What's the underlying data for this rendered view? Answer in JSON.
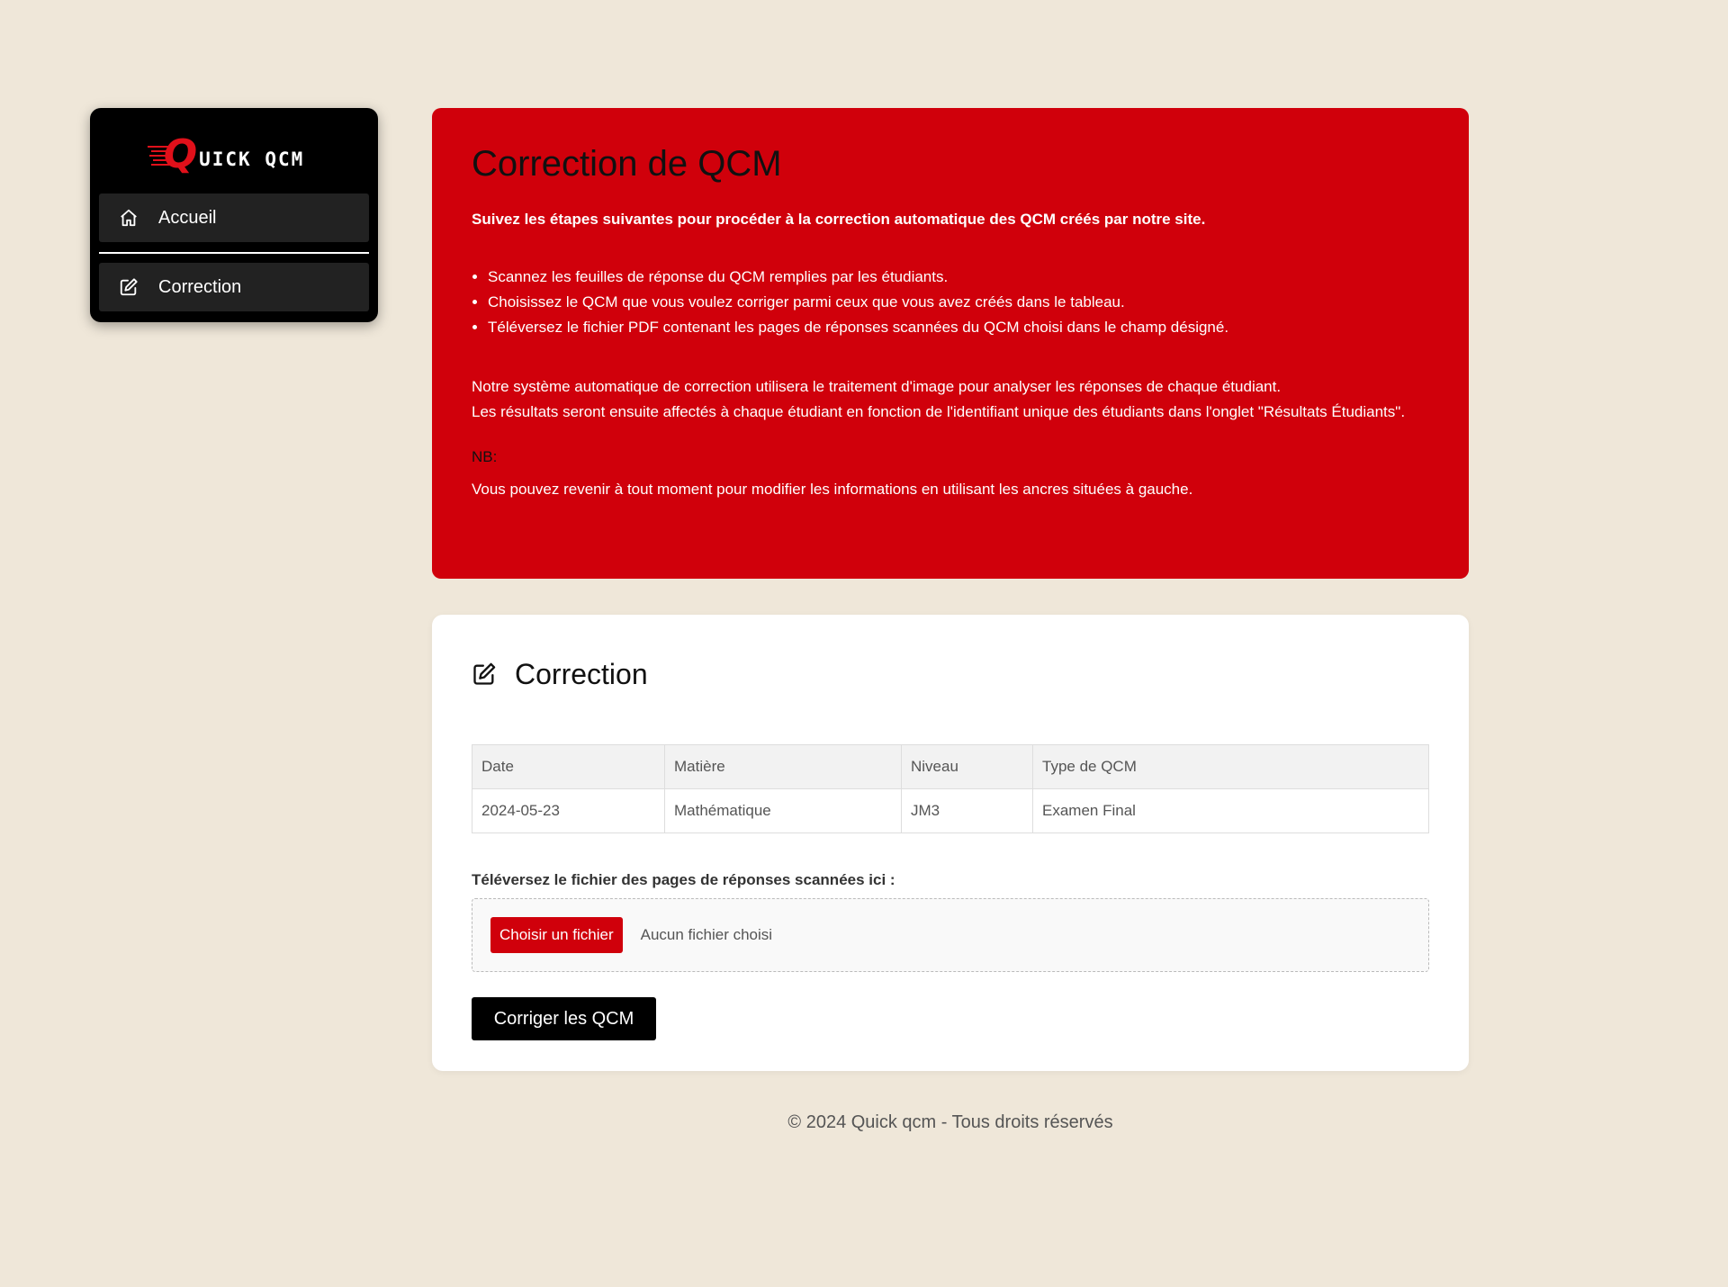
{
  "sidebar": {
    "logo": {
      "initial": "Q",
      "rest": "uick qcm"
    },
    "items": [
      {
        "label": "Accueil",
        "icon": "home-icon"
      },
      {
        "label": "Correction",
        "icon": "edit-icon"
      }
    ]
  },
  "intro": {
    "title": "Correction de QCM",
    "lead": "Suivez les étapes suivantes pour procéder à la correction automatique des QCM créés par notre site.",
    "steps": [
      "Scannez les feuilles de réponse du QCM remplies par les étudiants.",
      "Choisissez le QCM que vous voulez corriger parmi ceux que vous avez créés dans le tableau.",
      "Téléversez le fichier PDF contenant les pages de réponses scannées du QCM choisi dans le champ désigné."
    ],
    "para1": "Notre système automatique de correction utilisera le traitement d'image pour analyser les réponses de chaque étudiant.",
    "para2": "Les résultats seront ensuite affectés à chaque étudiant en fonction de l'identifiant unique des étudiants dans l'onglet \"Résultats Étudiants\".",
    "nb": "NB:",
    "note": "Vous pouvez revenir à tout moment pour modifier les informations en utilisant les ancres situées à gauche."
  },
  "correction": {
    "title": "Correction",
    "table": {
      "headers": [
        "Date",
        "Matière",
        "Niveau",
        "Type de QCM"
      ],
      "rows": [
        [
          "2024-05-23",
          "Mathématique",
          "JM3",
          "Examen Final"
        ]
      ]
    },
    "upload_label": "Téléversez le fichier des pages de réponses scannées ici :",
    "choose_label": "Choisir un fichier",
    "no_file": "Aucun fichier choisi",
    "submit_label": "Corriger les QCM"
  },
  "footer": "© 2024 Quick qcm - Tous droits réservés",
  "colors": {
    "accent": "#d0000b",
    "background": "#efe7d9",
    "sidebar": "#000000"
  }
}
